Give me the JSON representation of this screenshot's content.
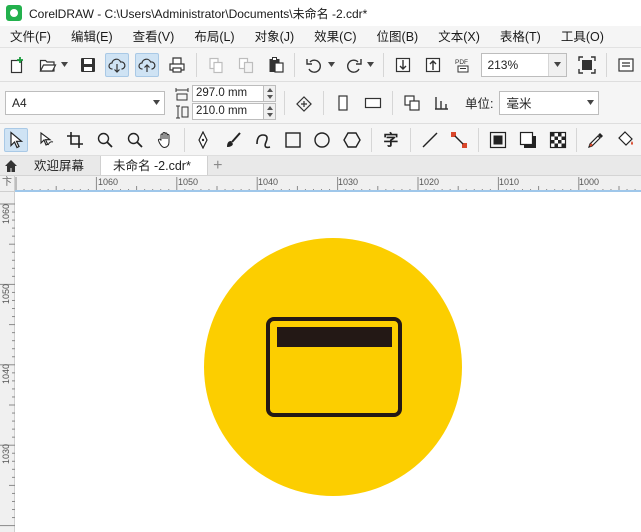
{
  "window": {
    "title": "CorelDRAW - C:\\Users\\Administrator\\Documents\\未命名 -2.cdr*"
  },
  "menu": [
    {
      "label": "文件(F)"
    },
    {
      "label": "编辑(E)"
    },
    {
      "label": "查看(V)"
    },
    {
      "label": "布局(L)"
    },
    {
      "label": "对象(J)"
    },
    {
      "label": "效果(C)"
    },
    {
      "label": "位图(B)"
    },
    {
      "label": "文本(X)"
    },
    {
      "label": "表格(T)"
    },
    {
      "label": "工具(O)"
    }
  ],
  "standard_toolbar": {
    "zoom_value": "213%",
    "pdf_label": "PDF"
  },
  "property_bar": {
    "page_size": "A4",
    "width": "297.0 mm",
    "height": "210.0 mm",
    "unit_label": "单位:",
    "unit_value": "毫米"
  },
  "toolbox": {
    "text_tool_glyph": "字"
  },
  "tabs": {
    "welcome": "欢迎屏幕",
    "document": "未命名 -2.cdr*",
    "add": "+"
  },
  "rulers": {
    "horizontal": [
      "1060",
      "1050",
      "1040",
      "1030",
      "1020",
      "1010",
      "1000"
    ],
    "vertical": [
      "1060",
      "1050",
      "1040",
      "1030"
    ],
    "corner_glyph": "卞"
  },
  "artwork": {
    "circle_color": "#FCCE00",
    "card_stroke_color": "#231815",
    "icon_name": "credit-card-icon"
  },
  "colors": {
    "app_green": "#23B14D",
    "chrome": "#F5F5F5",
    "active_highlight": "#CFE3F4"
  }
}
